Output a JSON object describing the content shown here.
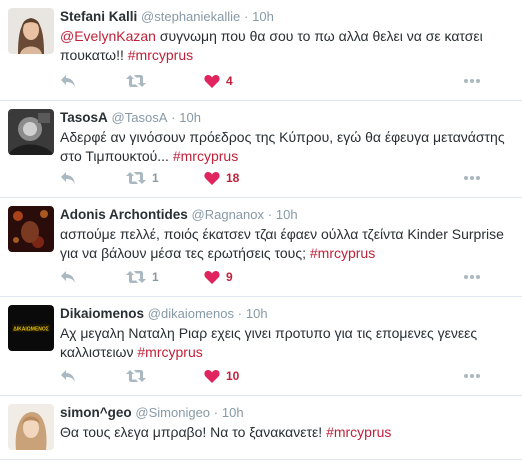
{
  "colors": {
    "accent": "#c0213a",
    "muted": "#8899a6",
    "text": "#292f33",
    "divider": "#e1e8ed"
  },
  "tweets": [
    {
      "fullname": "Stefani Kalli",
      "username": "@stephaniekallie",
      "separator": "·",
      "time": "10h",
      "mention": "@EvelynKazan",
      "text": " συγνωμη που θα σου το πω αλλα θελει να σε κατσει πουκατω!! ",
      "hashtag": "#mrcyprus",
      "retweets": "",
      "likes": "4"
    },
    {
      "fullname": "TasosA",
      "username": "@TasosA",
      "separator": "·",
      "time": "10h",
      "mention": "",
      "text": "Αδερφέ αν γινόσουν πρόεδρος της Κύπρου, εγώ θα έφευγα μετανάστης στο Τιμπουκτού... ",
      "hashtag": "#mrcyprus",
      "retweets": "1",
      "likes": "18"
    },
    {
      "fullname": "Adonis Archontides",
      "username": "@Ragnanox",
      "separator": "·",
      "time": "10h",
      "mention": "",
      "text": "ασπούμε πελλέ, ποιός έκατσεν τζαι έφαεν ούλλα τζείντα Kinder Surprise για να βάλουν μέσα τες ερωτήσεις τους; ",
      "hashtag": "#mrcyprus",
      "retweets": "1",
      "likes": "9"
    },
    {
      "fullname": "Dikaiomenos",
      "username": "@dikaiomenos",
      "separator": "·",
      "time": "10h",
      "mention": "",
      "text": "Αχ μεγαλη Ναταλη Ριαρ εχεις γινει προτυπο για τις επομενες γενεες καλλιστειων ",
      "hashtag": "#mrcyprus",
      "retweets": "",
      "likes": "10",
      "avatar_logo": "ΔΙΚΑΙΩΜΕΝΟΣ"
    },
    {
      "fullname": "simon^geo",
      "username": "@Simonigeo",
      "separator": "·",
      "time": "10h",
      "mention": "",
      "text": "Θα τους ελεγα μπραβο! Να το ξανακανετε! ",
      "hashtag": "#mrcyprus",
      "retweets": "",
      "likes": ""
    }
  ]
}
